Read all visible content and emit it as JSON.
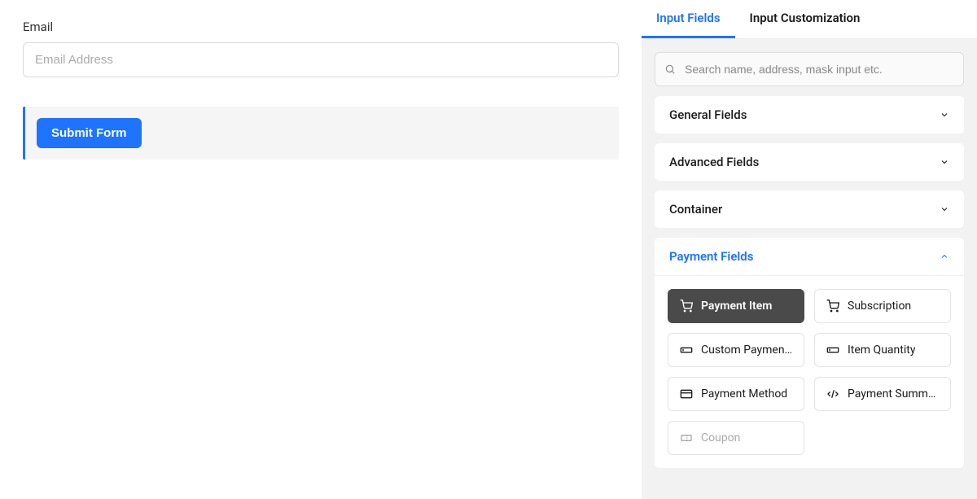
{
  "form": {
    "email_label": "Email",
    "email_placeholder": "Email Address",
    "submit_label": "Submit Form"
  },
  "sidebar": {
    "tabs": {
      "input_fields": "Input Fields",
      "customization": "Input Customization"
    },
    "search_placeholder": "Search name, address, mask input etc.",
    "sections": {
      "general": "General Fields",
      "advanced": "Advanced Fields",
      "container": "Container",
      "payment": "Payment Fields"
    },
    "payment_fields": {
      "payment_item": "Payment Item",
      "subscription": "Subscription",
      "custom_payment": "Custom Paymen...",
      "item_quantity": "Item Quantity",
      "payment_method": "Payment Method",
      "payment_summary": "Payment Summa...",
      "coupon": "Coupon"
    }
  }
}
